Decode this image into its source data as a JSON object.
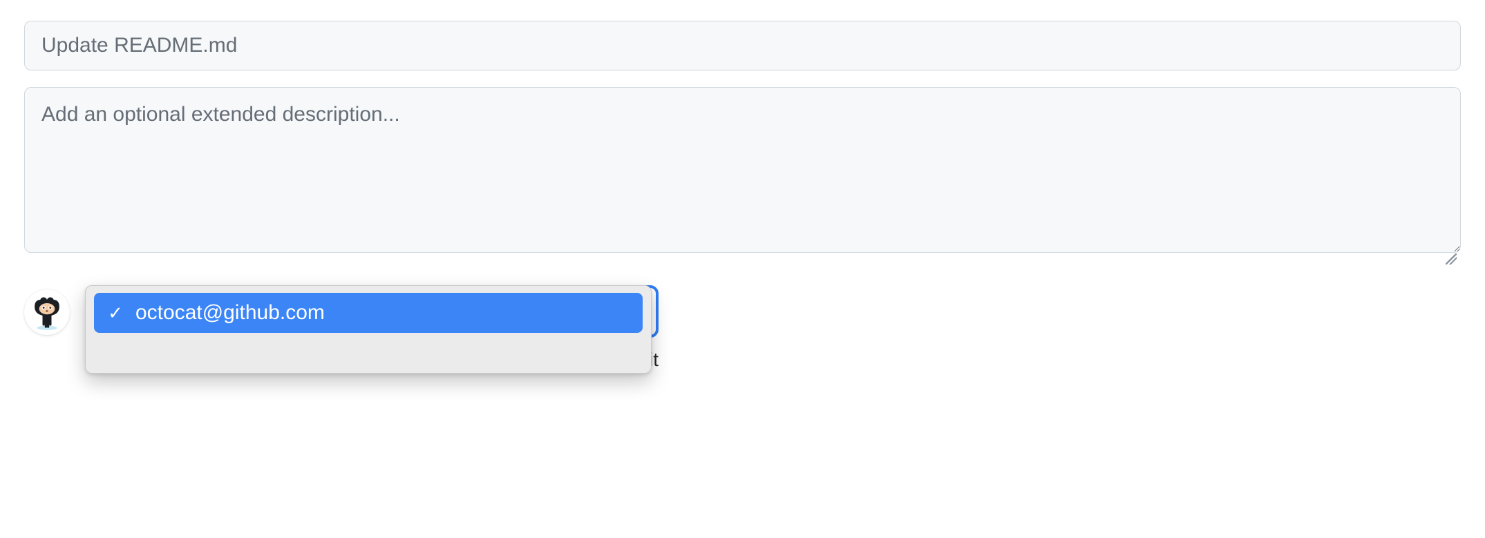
{
  "commit": {
    "summary_placeholder": "Update README.md",
    "summary_value": "",
    "description_placeholder": "Add an optional extended description...",
    "description_value": ""
  },
  "author_dropdown": {
    "options": [
      {
        "email": "octocat@github.com",
        "selected": true
      }
    ]
  },
  "partial_button_text_behind": "it",
  "avatar": {
    "name": "octocat"
  }
}
